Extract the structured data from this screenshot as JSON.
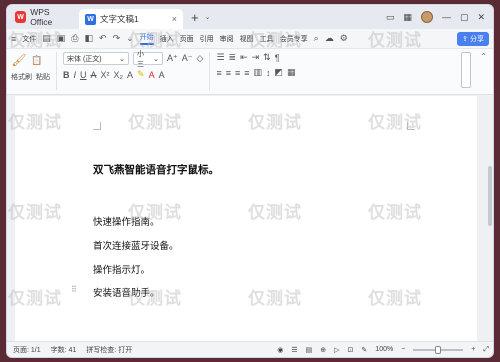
{
  "titlebar": {
    "app_name": "WPS Office",
    "app_logo": "W",
    "doc_tab_label": "文字文稿1",
    "doc_icon": "W",
    "close_glyph": "×",
    "new_tab_glyph": "+",
    "chevron_glyph": "⌄",
    "icons": [
      "window-icon",
      "grid-icon",
      "avatar",
      "minimize-icon",
      "maximize-icon",
      "close-icon"
    ]
  },
  "menubar": {
    "file": "文件",
    "items": [
      "开始",
      "插入",
      "页面",
      "引用",
      "审阅",
      "视图",
      "工具",
      "会员专享"
    ],
    "active": "开始",
    "share": "分享"
  },
  "ribbon": {
    "font_name": "宋体 (正文)",
    "font_size": "小三",
    "format_painter": "格式刷",
    "paste": "粘贴"
  },
  "document": {
    "title": "双飞燕智能语音打字鼠标。",
    "paragraphs": [
      "快速操作指南。",
      "首次连接蓝牙设备。",
      "操作指示灯。",
      "安装语音助手。"
    ]
  },
  "statusbar": {
    "page": "页面: 1/1",
    "word_count": "字数: 41",
    "spell_check": "拼写检查: 打开",
    "zoom": "100%"
  },
  "watermark": "仅测试"
}
